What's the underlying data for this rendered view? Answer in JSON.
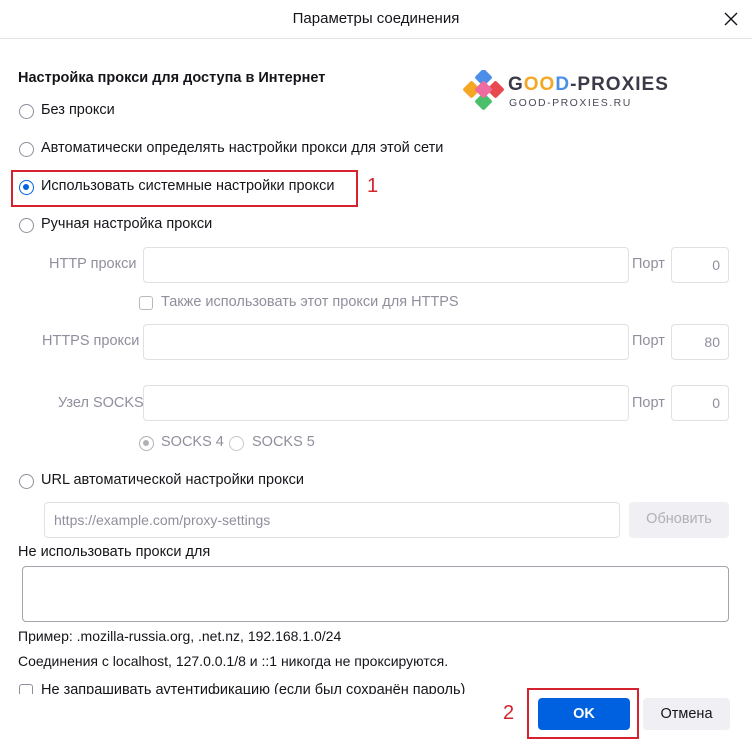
{
  "dialog": {
    "title": "Параметры соединения"
  },
  "logo": {
    "brand_prefix": "G",
    "brand_oo": "OO",
    "brand_d": "D",
    "brand_rest": "-PROXIES",
    "subtitle": "GOOD-PROXIES.RU"
  },
  "proxy": {
    "heading": "Настройка прокси для доступа в Интернет",
    "options": [
      {
        "label": "Без прокси",
        "selected": false
      },
      {
        "label": "Автоматически определять настройки прокси для этой сети",
        "selected": false
      },
      {
        "label": "Использовать системные настройки прокси",
        "selected": true
      },
      {
        "label": "Ручная настройка прокси",
        "selected": false
      }
    ],
    "http_label": "HTTP прокси",
    "http_value": "",
    "port_label": "Порт",
    "http_port": "0",
    "also_https_label": "Также использовать этот прокси для HTTPS",
    "https_label": "HTTPS прокси",
    "https_value": "",
    "https_port": "80",
    "socks_label": "Узел SOCKS",
    "socks_value": "",
    "socks_port": "0",
    "socks4_label": "SOCKS 4",
    "socks5_label": "SOCKS 5",
    "pac_label": "URL автоматической настройки прокси",
    "pac_placeholder": "https://example.com/proxy-settings",
    "reload_label": "Обновить"
  },
  "no_proxy": {
    "label": "Не использовать прокси для",
    "value": "",
    "example": "Пример: .mozilla-russia.org, .net.nz, 192.168.1.0/24",
    "localhost_note": "Соединения с localhost, 127.0.0.1/8 и ::1 никогда не проксируются."
  },
  "auth_checkbox_label": "Не запрашивать аутентификацию (если был сохранён пароль)",
  "annotations": {
    "step1": "1",
    "step2": "2"
  },
  "buttons": {
    "ok": "OK",
    "cancel": "Отмена"
  },
  "colors": {
    "accent": "#0061e0",
    "annotation_red": "#d4232c"
  }
}
